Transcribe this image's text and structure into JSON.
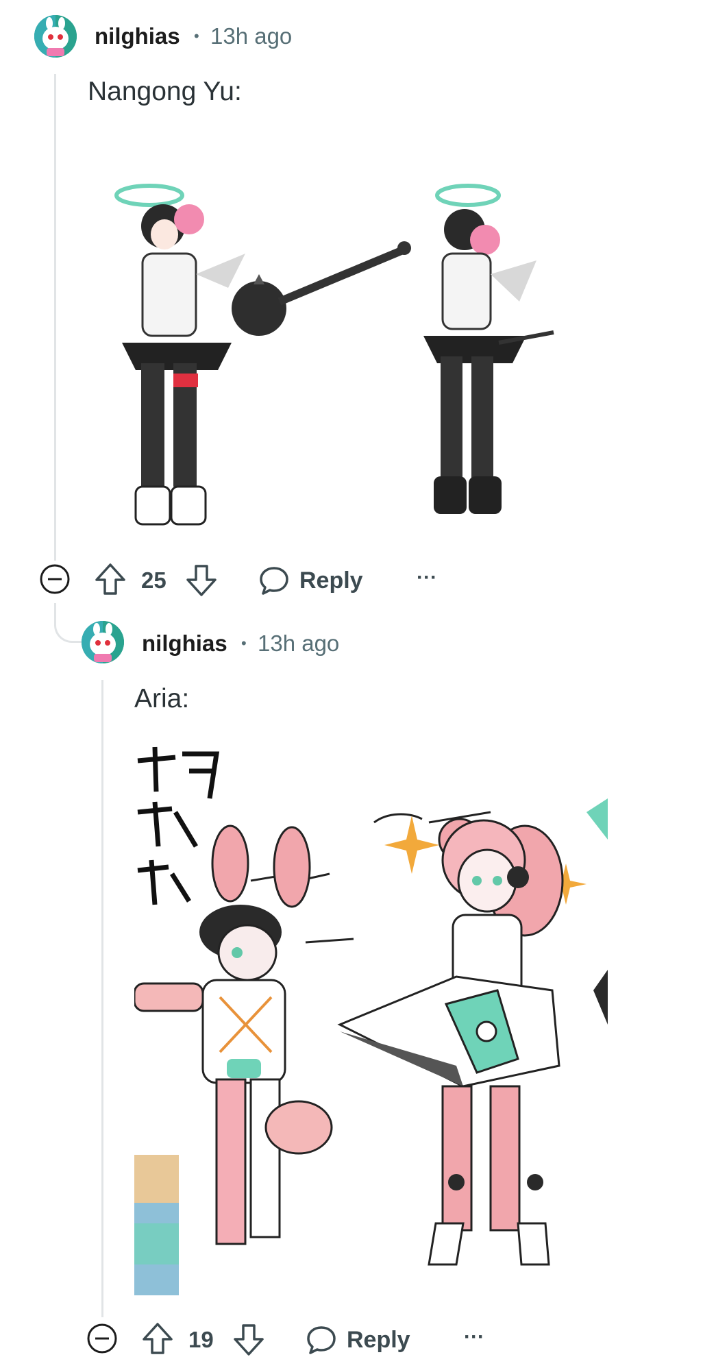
{
  "comments": [
    {
      "username": "nilghias",
      "separator": "•",
      "time": "13h ago",
      "text": "Nangong Yu:",
      "score": "25",
      "reply_label": "Reply",
      "more_label": "···"
    },
    {
      "username": "nilghias",
      "separator": "•",
      "time": "13h ago",
      "text": "Aria:",
      "score": "19",
      "reply_label": "Reply",
      "more_label": "···"
    }
  ],
  "colors": {
    "avatar_bg": "#2aa38f",
    "meta_gray": "#576f76",
    "action_gray": "#3c4a50",
    "thread_line": "#e1e4e6"
  },
  "icons": {
    "collapse": "minus-circle-icon",
    "upvote": "arrow-up-icon",
    "downvote": "arrow-down-icon",
    "reply": "speech-bubble-icon",
    "more": "ellipsis-icon"
  }
}
